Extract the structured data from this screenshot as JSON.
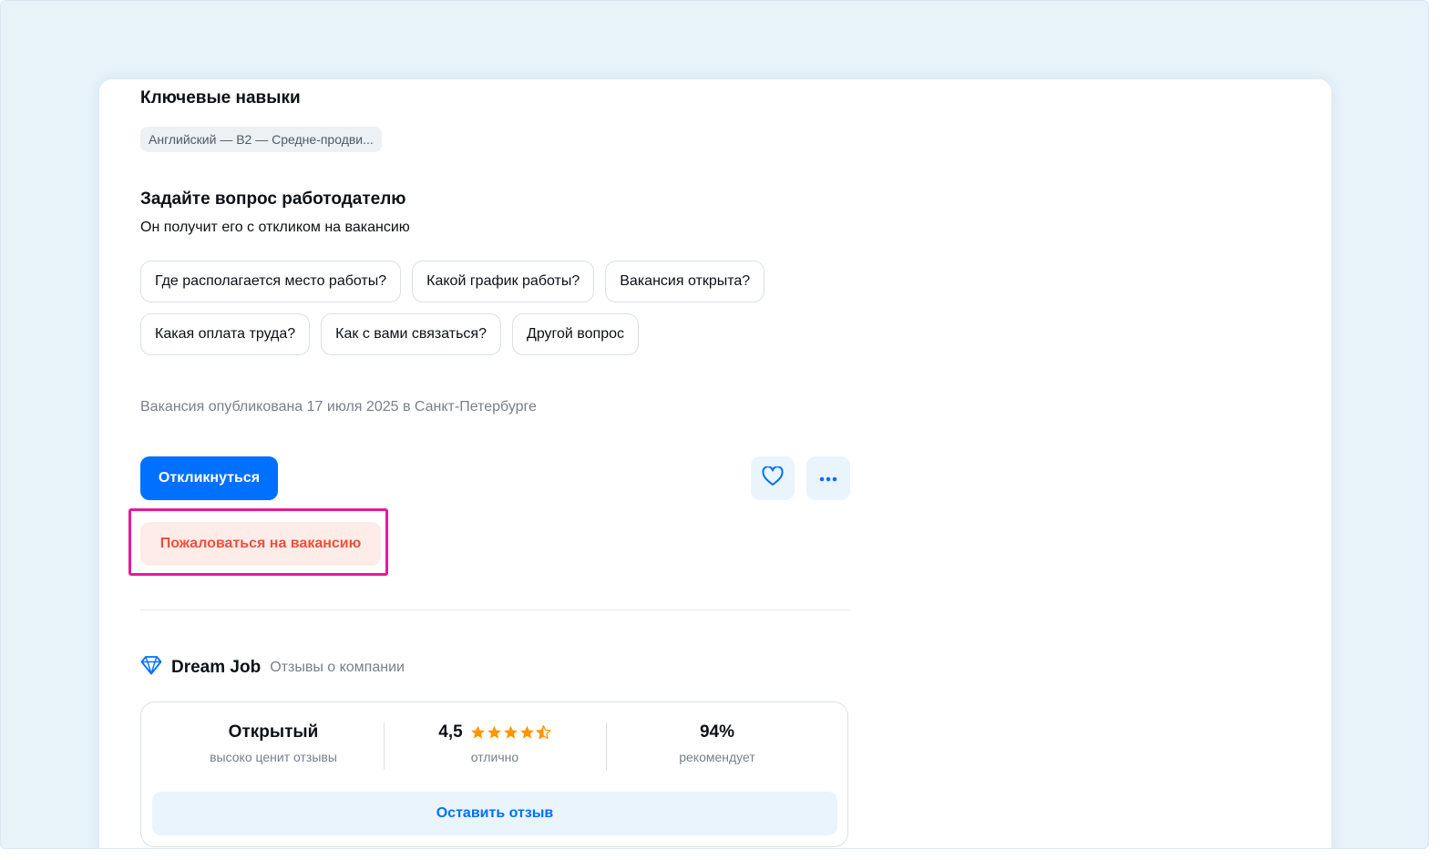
{
  "skills": {
    "title": "Ключевые навыки",
    "items": [
      "Английский — B2 — Средне-продви..."
    ]
  },
  "ask": {
    "title": "Задайте вопрос работодателю",
    "subtitle": "Он получит его с откликом на вакансию",
    "questions": [
      "Где располагается место работы?",
      "Какой график работы?",
      "Вакансия открыта?",
      "Какая оплата труда?",
      "Как с вами связаться?",
      "Другой вопрос"
    ]
  },
  "published": "Вакансия опубликована 17 июля 2025 в Санкт-Петербурге",
  "actions": {
    "respond_label": "Откликнуться",
    "favorite_icon": "heart-icon",
    "more_icon": "more-dots-icon",
    "complain_label": "Пожаловаться на вакансию"
  },
  "company": {
    "icon": "diamond-icon",
    "name": "Dream Job",
    "reviews_label": "Отзывы о компании",
    "stats": [
      {
        "value": "Открытый",
        "label": "высоко ценит отзывы"
      },
      {
        "value": "4,5",
        "label": "отлично",
        "stars": 4.5
      },
      {
        "value": "94%",
        "label": "рекомендует"
      }
    ],
    "leave_review_label": "Оставить отзыв"
  },
  "colors": {
    "primary": "#0070ff",
    "complain_text": "#f0503a",
    "complain_bg": "#fdece8",
    "highlight": "#e8199a",
    "star": "#ff9500"
  }
}
